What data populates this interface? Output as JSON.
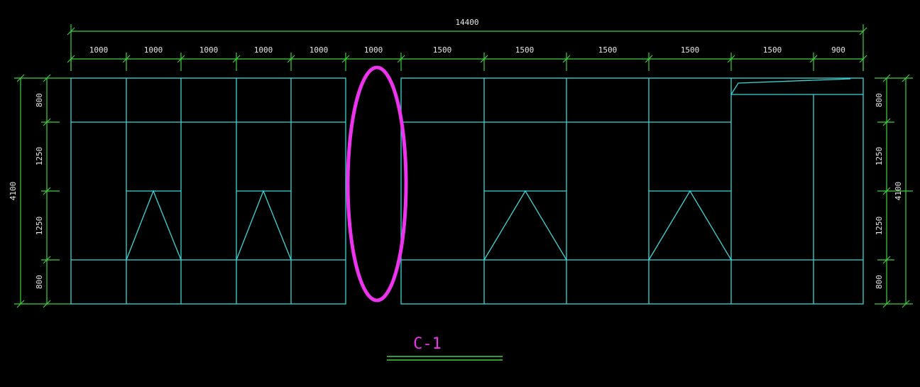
{
  "drawing": {
    "title": "C-1",
    "total_width_label": "14400",
    "column_widths": [
      "1000",
      "1000",
      "1000",
      "1000",
      "1000",
      "1000",
      "1500",
      "1500",
      "1500",
      "1500",
      "1500",
      "900"
    ],
    "row_heights_left": [
      "800",
      "1250",
      "1250",
      "800"
    ],
    "row_heights_right": [
      "800",
      "1250",
      "1250",
      "800"
    ],
    "total_height_label_left": "4100",
    "total_height_label_right": "4100",
    "colors": {
      "dimension": "#3fd03f",
      "frame": "#3bd6d6",
      "highlight": "#ee33ee",
      "text": "#e8e8e8"
    }
  }
}
